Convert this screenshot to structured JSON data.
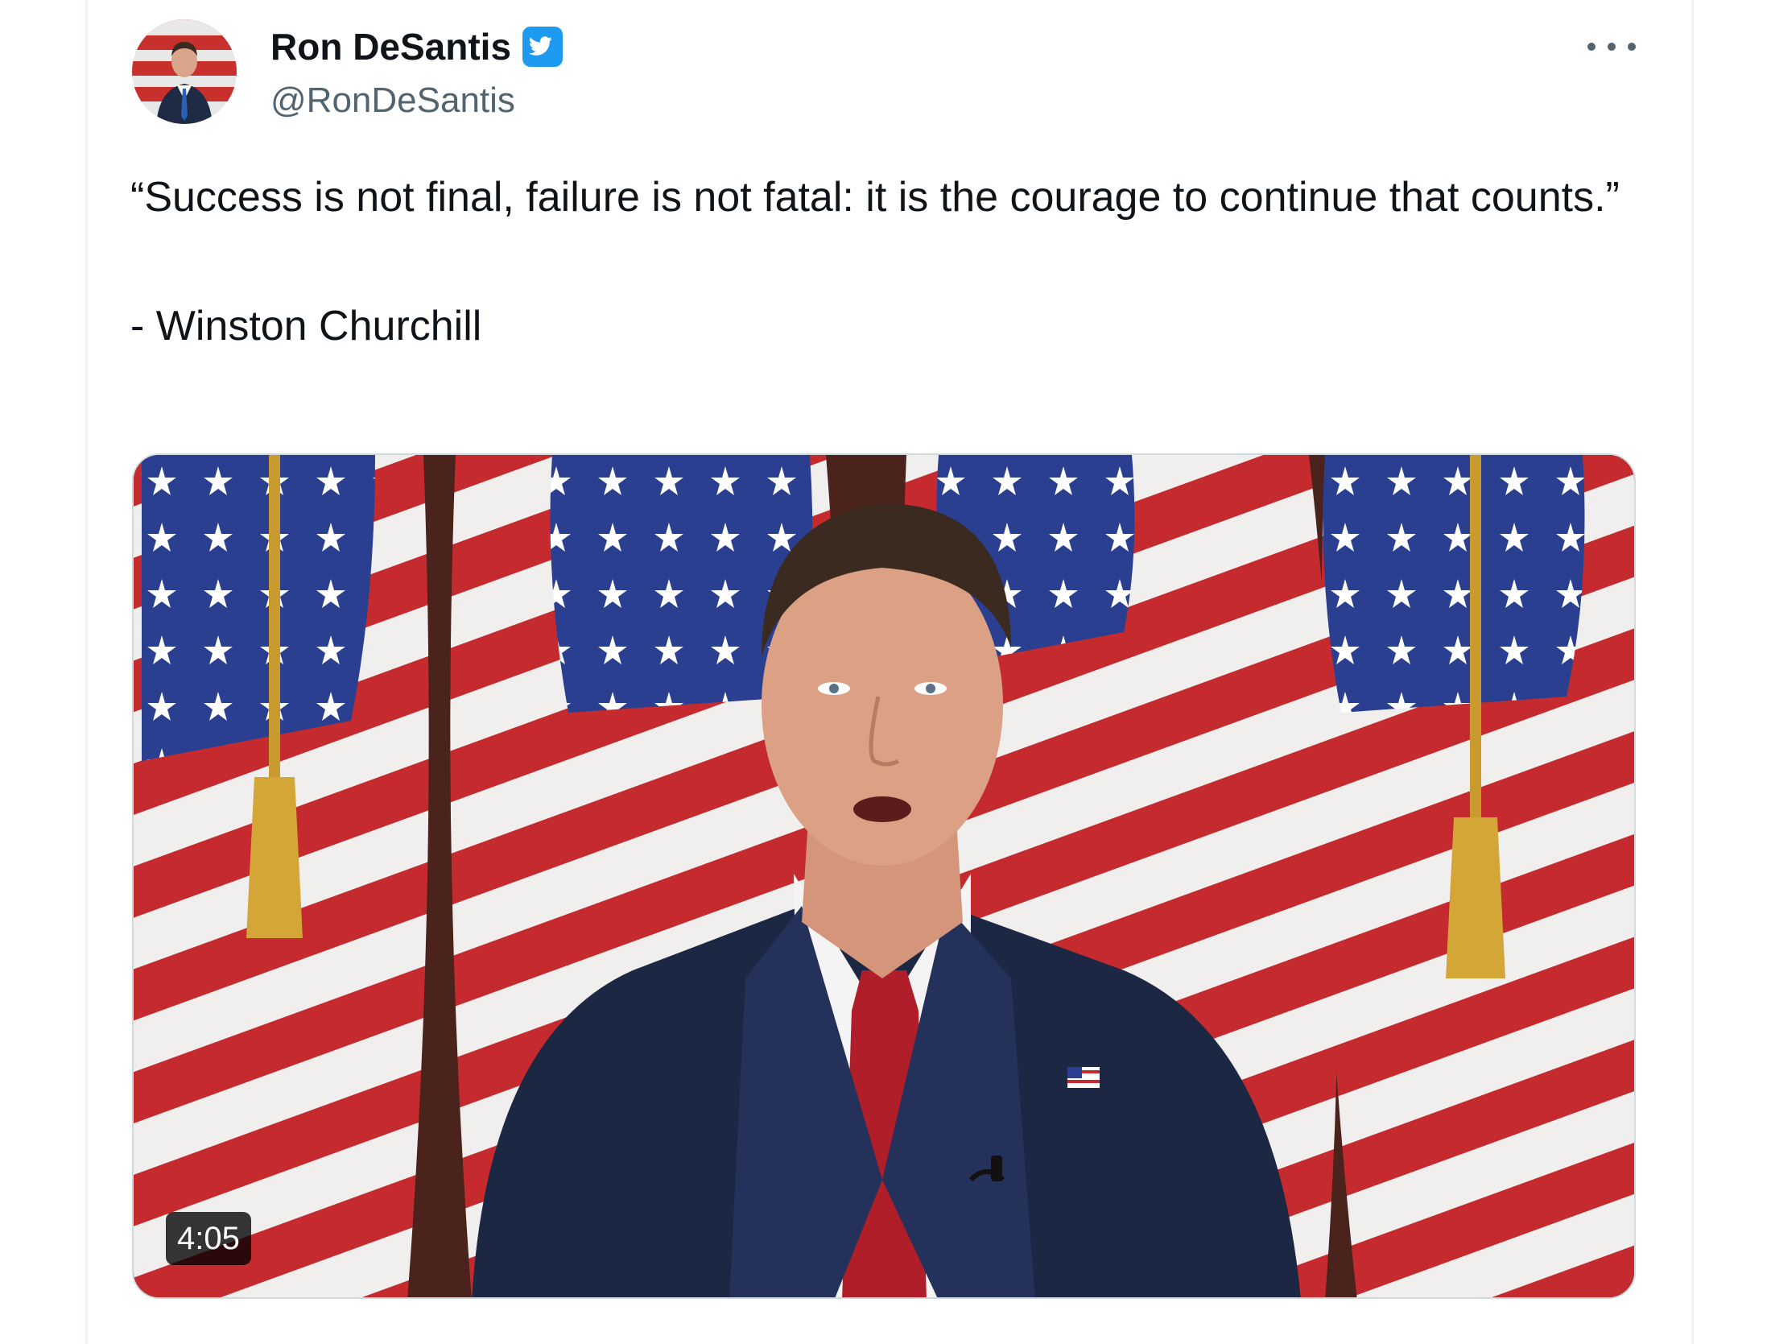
{
  "tweet": {
    "display_name": "Ron DeSantis",
    "handle": "@RonDeSantis",
    "verified_icon": "verified-badge-icon",
    "more_icon": "more-options-icon",
    "text": "“Success is not final, failure is not fatal: it is the courage to continue that counts.”\n\n- Winston Churchill"
  },
  "media": {
    "type": "video",
    "duration": "4:05"
  },
  "colors": {
    "text_primary": "#0f1419",
    "text_secondary": "#536471",
    "verified_blue": "#1d9bf0",
    "border": "#eff3f4"
  }
}
